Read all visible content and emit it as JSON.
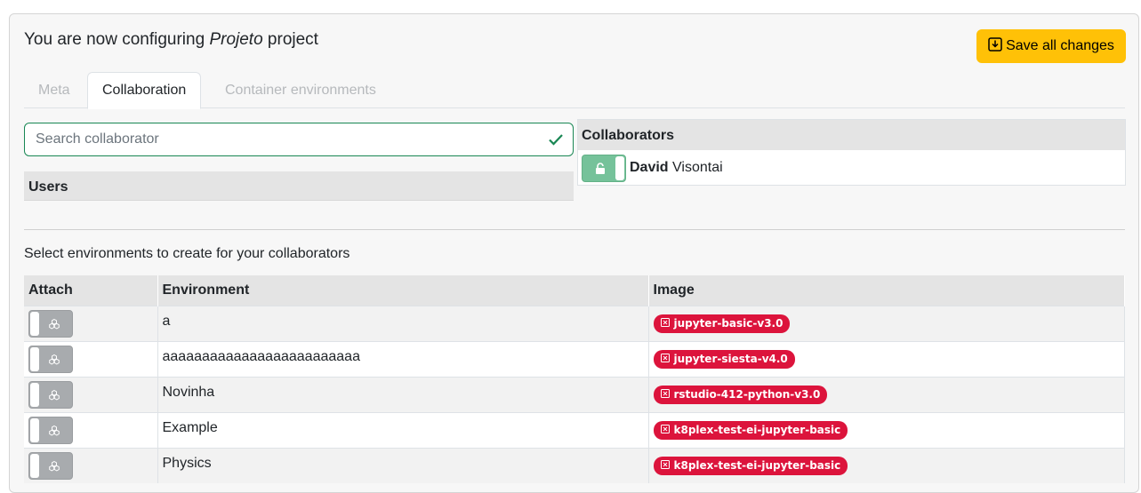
{
  "header": {
    "title_prefix": "You are now configuring ",
    "project_name": "Projeto",
    "title_suffix": " project",
    "save_label": "Save all changes"
  },
  "tabs": [
    {
      "label": "Meta",
      "active": false
    },
    {
      "label": "Collaboration",
      "active": true
    },
    {
      "label": "Container environments",
      "active": false
    }
  ],
  "search": {
    "placeholder": "Search collaborator",
    "value": ""
  },
  "users": {
    "header": "Users"
  },
  "collaborators": {
    "header": "Collaborators",
    "items": [
      {
        "first": "David",
        "last": " Visontai"
      }
    ]
  },
  "environments": {
    "label": "Select environments to create for your collaborators",
    "columns": [
      "Attach",
      "Environment",
      "Image"
    ],
    "rows": [
      {
        "name": "a",
        "image": "jupyter-basic-v3.0"
      },
      {
        "name": "aaaaaaaaaaaaaaaaaaaaaaaaa",
        "image": "jupyter-siesta-v4.0"
      },
      {
        "name": "Novinha",
        "image": "rstudio-412-python-v3.0"
      },
      {
        "name": "Example",
        "image": "k8plex-test-ei-jupyter-basic"
      },
      {
        "name": "Physics",
        "image": "k8plex-test-ei-jupyter-basic"
      }
    ]
  },
  "colors": {
    "save": "#ffc107",
    "badge": "#dc143c",
    "valid": "#198754",
    "lock_toggle": "#75c29a"
  }
}
